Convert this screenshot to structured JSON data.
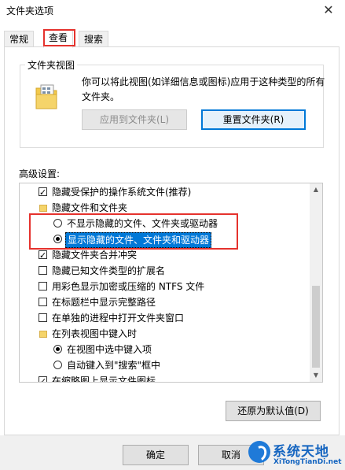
{
  "window": {
    "title": "文件夹选项",
    "close_glyph": "✕"
  },
  "tabs": [
    {
      "label": "常规",
      "active": false
    },
    {
      "label": "查看",
      "active": true
    },
    {
      "label": "搜索",
      "active": false
    }
  ],
  "folder_views": {
    "group_title": "文件夹视图",
    "icon": "folder-view-icon",
    "description": "你可以将此视图(如详细信息或图标)应用于这种类型的所有文件夹。",
    "apply_button": "应用到文件夹(L)",
    "reset_button": "重置文件夹(R)"
  },
  "advanced": {
    "label": "高级设置:",
    "items": [
      {
        "kind": "checkbox",
        "checked": true,
        "label": "隐藏受保护的操作系统文件(推荐)"
      },
      {
        "kind": "folder",
        "label": "隐藏文件和文件夹"
      },
      {
        "kind": "radio",
        "checked": false,
        "label": "不显示隐藏的文件、文件夹或驱动器"
      },
      {
        "kind": "radio",
        "checked": true,
        "selected": true,
        "label": "显示隐藏的文件、文件夹和驱动器"
      },
      {
        "kind": "checkbox",
        "checked": true,
        "label": "隐藏文件夹合并冲突"
      },
      {
        "kind": "checkbox",
        "checked": false,
        "label": "隐藏已知文件类型的扩展名"
      },
      {
        "kind": "checkbox",
        "checked": false,
        "label": "用彩色显示加密或压缩的 NTFS 文件"
      },
      {
        "kind": "checkbox",
        "checked": false,
        "label": "在标题栏中显示完整路径"
      },
      {
        "kind": "checkbox",
        "checked": false,
        "label": "在单独的进程中打开文件夹窗口"
      },
      {
        "kind": "folder",
        "label": "在列表视图中键入时"
      },
      {
        "kind": "radio",
        "checked": true,
        "label": "在视图中选中键入项"
      },
      {
        "kind": "radio",
        "checked": false,
        "label": "自动键入到\"搜索\"框中"
      },
      {
        "kind": "checkbox",
        "checked": true,
        "label": "在缩略图上显示文件图标"
      }
    ],
    "restore_button": "还原为默认值(D)"
  },
  "footer": {
    "ok_button": "确定",
    "cancel_button": "取消"
  },
  "watermark": {
    "title": "系统天地",
    "url": "XiTongTianDi.net"
  },
  "colors": {
    "highlight_box": "#e5322d",
    "selection": "#0078d7",
    "focus": "#0078d7"
  }
}
